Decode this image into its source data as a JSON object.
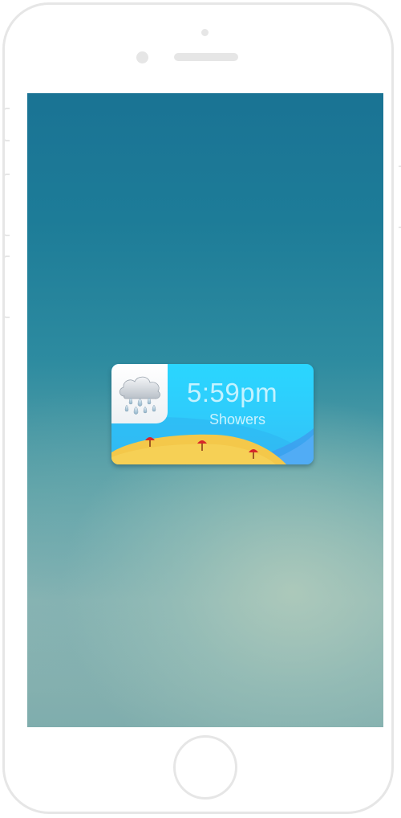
{
  "widget": {
    "time": "5:59pm",
    "condition": "Showers",
    "icon": "rain-cloud-icon"
  },
  "colors": {
    "widget_sky": "#2fcbfb",
    "sand": "#f4c84a",
    "umbrella": "#d8262a",
    "wallpaper_top": "#1a7394",
    "wallpaper_bottom": "#8fb6b3"
  }
}
